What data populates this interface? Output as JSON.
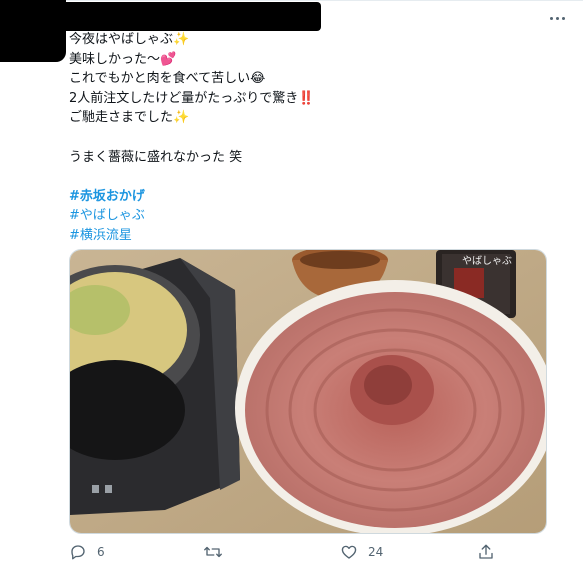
{
  "tweet": {
    "lines": [
      "今夜はやばしゃぶ✨",
      "美味しかった〜💕",
      "これでもかと肉を食べて苦しい😂",
      "2人前注文したけど量がたっぷりで驚き‼️",
      "ご馳走さまでした✨"
    ],
    "line2": "うまく薔薇に盛れなかった 笑",
    "hashtags": [
      "#赤坂おかげ",
      "#やばしゃぶ",
      "#横浜流星"
    ]
  },
  "media": {
    "bottle_label": "やばしゃぶ",
    "icons": [
      "hotpot-icon",
      "meat-plate-icon",
      "bowl-icon",
      "sauce-bottle-icon"
    ]
  },
  "actions": {
    "reply_count": "6",
    "retweet_count": "",
    "like_count": "24"
  },
  "colors": {
    "hashtag": "#1b95e0",
    "muted": "#536471",
    "border": "#cfd9de"
  }
}
